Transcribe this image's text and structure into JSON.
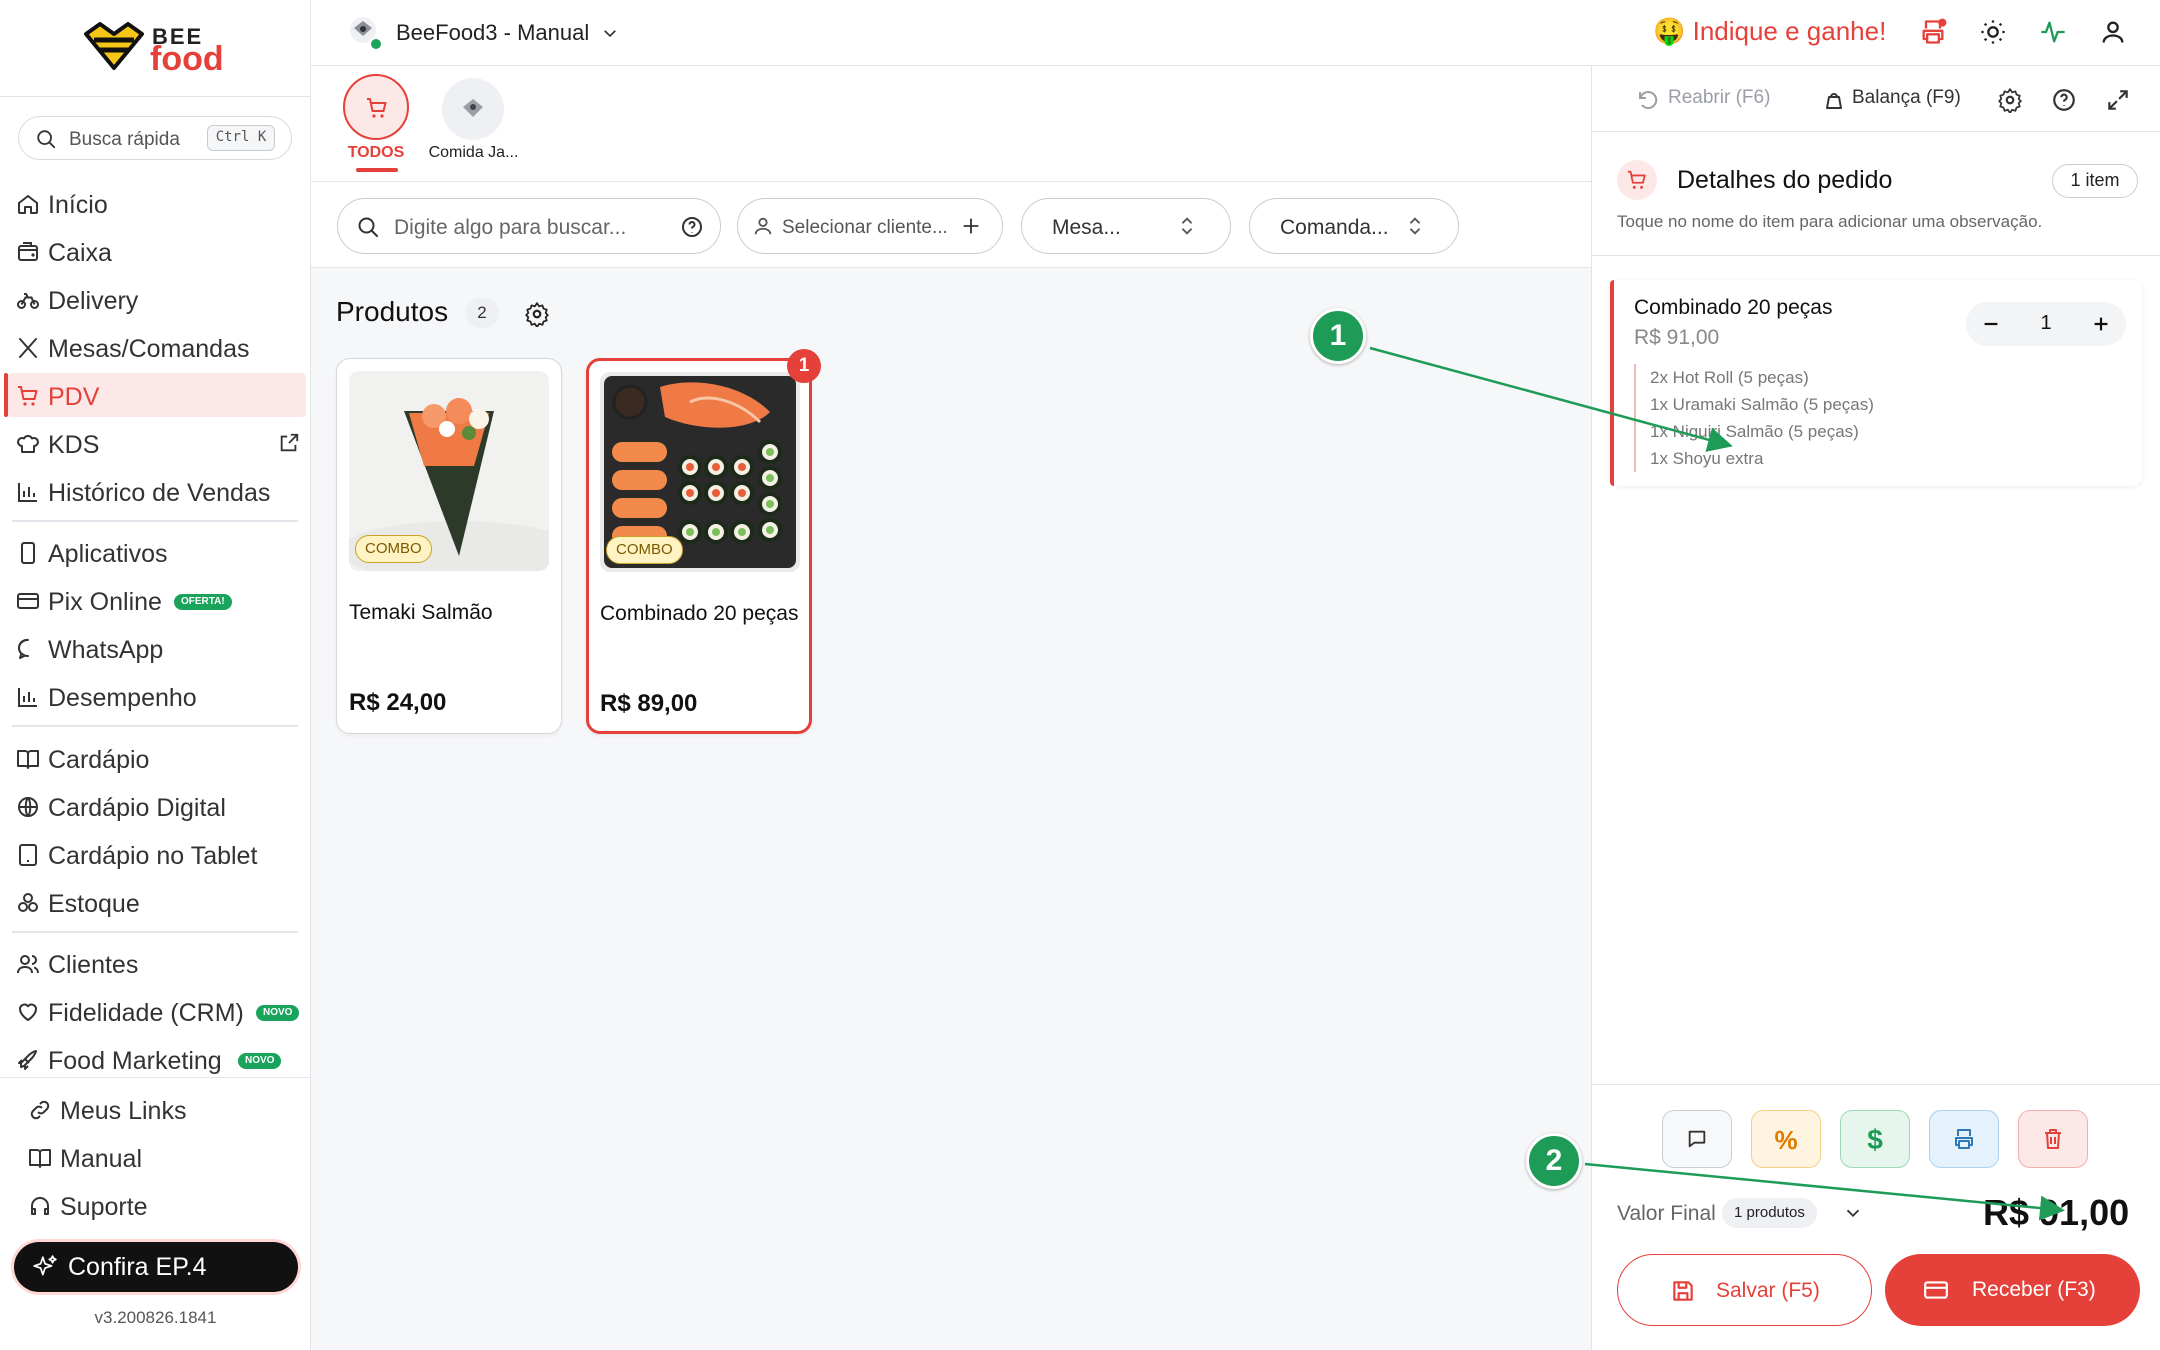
{
  "brand": {
    "line1": "BEE",
    "line2": "food"
  },
  "search": {
    "label": "Busca rápida",
    "shortcut": "Ctrl K"
  },
  "nav": [
    {
      "label": "Início",
      "icon": "home-icon"
    },
    {
      "label": "Caixa",
      "icon": "cash-register-icon"
    },
    {
      "label": "Delivery",
      "icon": "bike-icon"
    },
    {
      "label": "Mesas/Comandas",
      "icon": "utensils-icon"
    },
    {
      "label": "PDV",
      "icon": "cart-icon",
      "active": true
    },
    {
      "label": "KDS",
      "icon": "chef-hat-icon"
    },
    {
      "label": "Histórico de Vendas",
      "icon": "bar-chart-icon"
    },
    {
      "label": "Aplicativos",
      "icon": "smartphone-icon"
    },
    {
      "label": "Pix Online",
      "icon": "card-icon",
      "badge": "OFERTA!"
    },
    {
      "label": "WhatsApp",
      "icon": "chat-icon"
    },
    {
      "label": "Desempenho",
      "icon": "bar-chart-icon"
    },
    {
      "label": "Cardápio",
      "icon": "book-open-icon"
    },
    {
      "label": "Cardápio Digital",
      "icon": "globe-icon"
    },
    {
      "label": "Cardápio no Tablet",
      "icon": "tablet-icon"
    },
    {
      "label": "Estoque",
      "icon": "boxes-icon"
    },
    {
      "label": "Clientes",
      "icon": "users-icon"
    },
    {
      "label": "Fidelidade (CRM)",
      "icon": "heart-icon",
      "badge": "NOVO"
    },
    {
      "label": "Food Marketing",
      "icon": "rocket-icon",
      "badge": "NOVO"
    },
    {
      "label": "Meus Links",
      "icon": "link-icon"
    },
    {
      "label": "Manual",
      "icon": "book-icon"
    },
    {
      "label": "Suporte",
      "icon": "headset-icon"
    }
  ],
  "promo": {
    "label": "Confira EP.4"
  },
  "version": "v3.200826.1841",
  "topbar": {
    "store": "BeeFood3 - Manual",
    "referral": "🤑 Indique e ganhe!"
  },
  "categories": [
    {
      "label": "TODOS",
      "active": true
    },
    {
      "label": "Comida Ja..."
    }
  ],
  "filters": {
    "search_placeholder": "Digite algo para buscar...",
    "client": "Selecionar cliente...",
    "table": "Mesa...",
    "tab": "Comanda..."
  },
  "products": {
    "title": "Produtos",
    "count": "2",
    "items": [
      {
        "name": "Temaki Salmão",
        "price": "R$ 24,00",
        "tag": "COMBO"
      },
      {
        "name": "Combinado 20 peças",
        "price": "R$ 89,00",
        "tag": "COMBO",
        "selected_qty": "1"
      }
    ]
  },
  "panel": {
    "reopen": "Reabrir (F6)",
    "scale": "Balança (F9)",
    "title": "Detalhes do pedido",
    "items_pill": "1 item",
    "hint": "Toque no nome do item para adicionar uma observação.",
    "order_item": {
      "name": "Combinado 20 peças",
      "price": "R$ 91,00",
      "qty": "1",
      "modifiers": [
        "2x Hot Roll (5 peças)",
        "1x Uramaki Salmão (5 peças)",
        "1x Niguiri Salmão (5 peças)",
        "1x Shoyu extra"
      ]
    },
    "final_label": "Valor Final",
    "final_pill": "1 produtos",
    "total": "R$ 91,00",
    "save": "Salvar (F5)",
    "receive": "Receber (F3)"
  },
  "annotations": [
    "1",
    "2"
  ],
  "colors": {
    "accent": "#e5403a",
    "annotation": "#1e9b57",
    "badge": "#19a35b"
  }
}
